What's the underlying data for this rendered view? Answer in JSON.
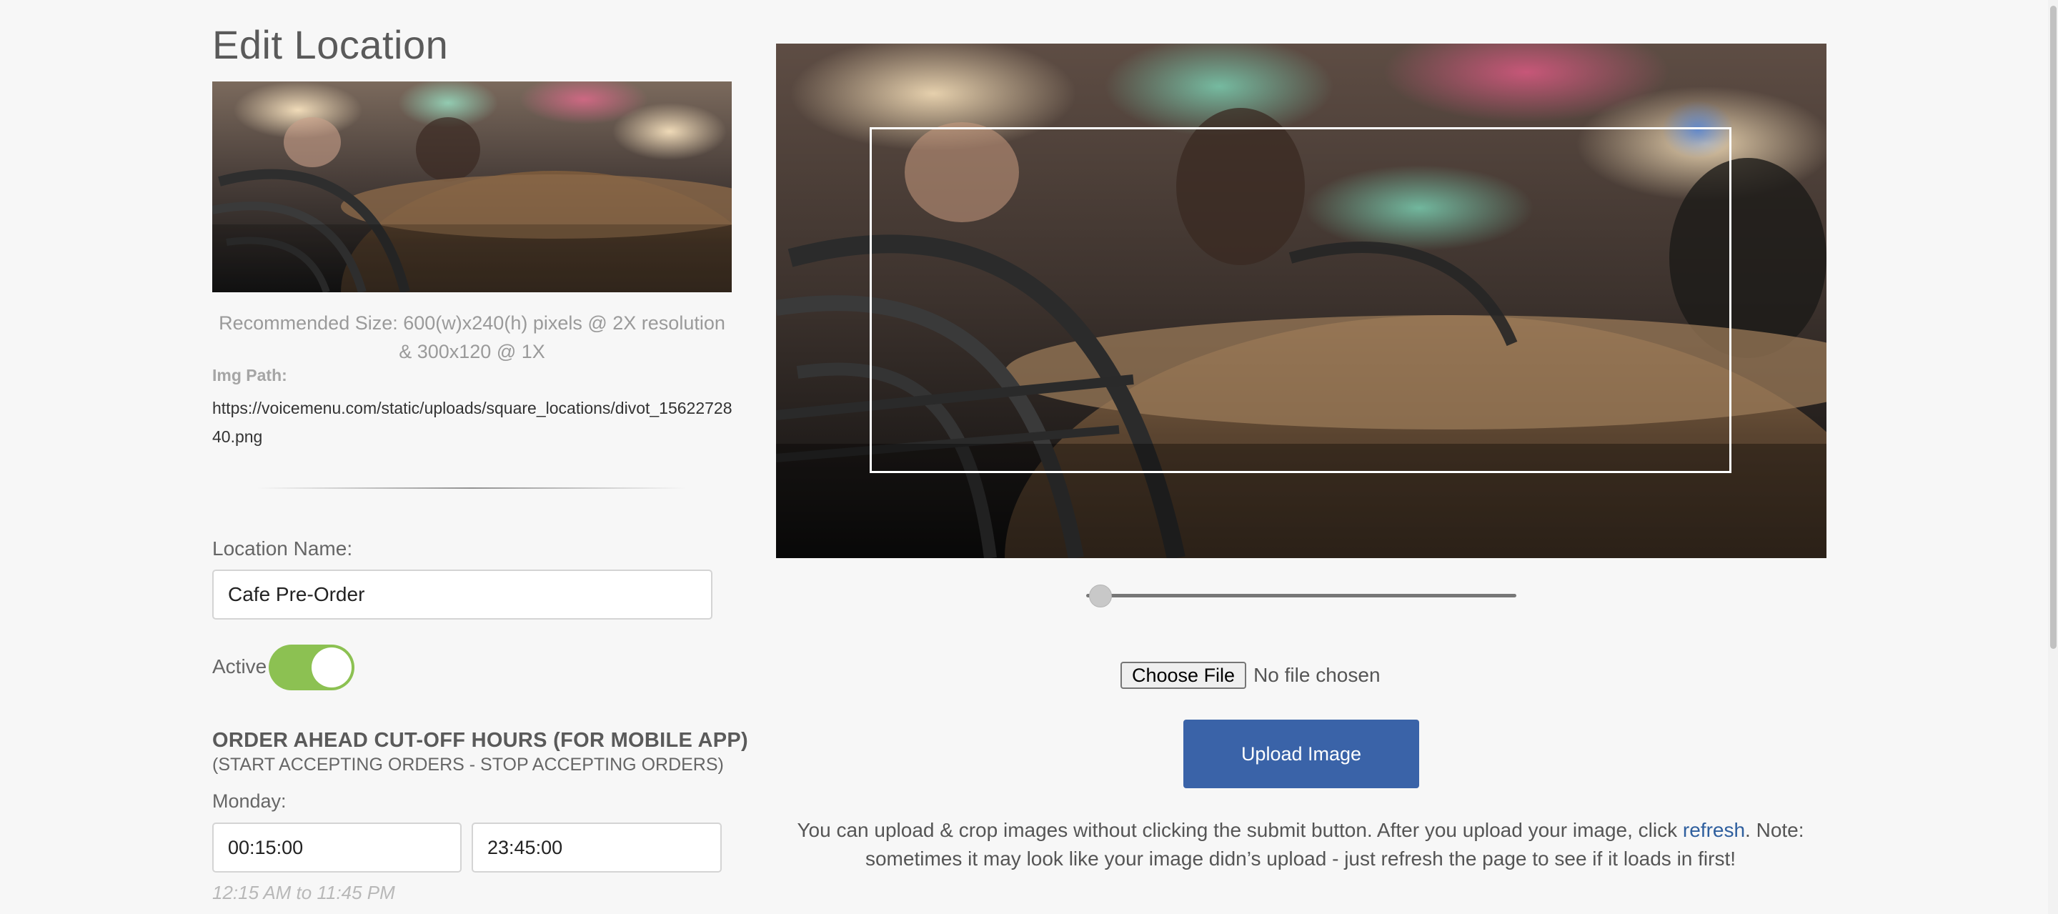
{
  "page": {
    "title": "Edit Location"
  },
  "image_info": {
    "recommended_size": "Recommended Size: 600(w)x240(h) pixels @ 2X resolution & 300x120 @ 1X",
    "img_path_label": "Img Path:",
    "img_path": "https://voicemenu.com/static/uploads/square_locations/divot_1562272840.png"
  },
  "location": {
    "name_label": "Location Name:",
    "name_value": "Cafe Pre-Order",
    "active_label": "Active",
    "active": true
  },
  "hours": {
    "title": "ORDER AHEAD CUT-OFF HOURS (FOR MOBILE APP)",
    "subtitle": "(START ACCEPTING ORDERS - STOP ACCEPTING ORDERS)",
    "days": [
      {
        "label": "Monday:",
        "open": "00:15:00",
        "close": "23:45:00",
        "hint": "12:15 AM to 11:45 PM"
      }
    ]
  },
  "uploader": {
    "zoom_level": 0.0,
    "choose_file_label": "Choose File",
    "file_status": "No file chosen",
    "upload_label": "Upload Image",
    "note_before": "You can upload & crop images without clicking the submit button. After you upload your image, click ",
    "note_link": "refresh",
    "note_after": ". Note: sometimes it may look like your image didn’s upload - just refresh the page to see if it loads in first!"
  },
  "colors": {
    "toggle_on": "#8cc152",
    "primary_button": "#3a63a8",
    "link": "#2f5f9e"
  }
}
